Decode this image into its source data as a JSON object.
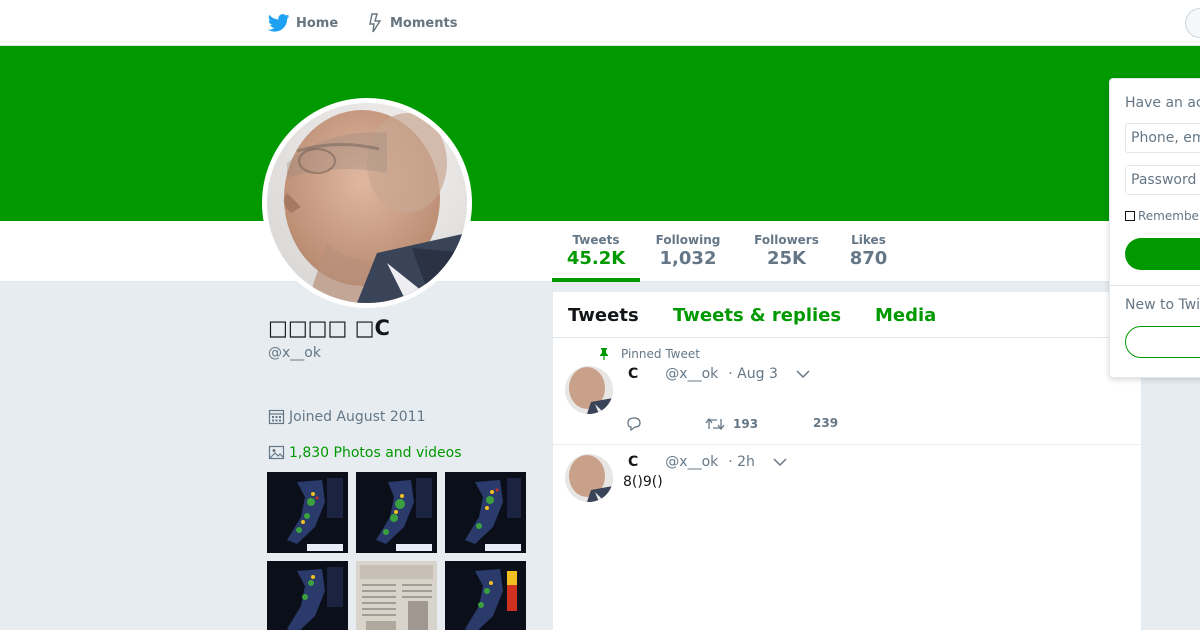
{
  "nav": {
    "home_label": "Home",
    "moments_label": "Moments"
  },
  "colors": {
    "theme": "#009900",
    "background": "#e6ecf0",
    "muted_text": "#657786"
  },
  "profile": {
    "name": "□□□□ □C",
    "handle": "@x__ok",
    "joined": "Joined August 2011",
    "photos_videos": "1,830 Photos and videos"
  },
  "stats": [
    {
      "label": "Tweets",
      "value": "45.2K"
    },
    {
      "label": "Following",
      "value": "1,032"
    },
    {
      "label": "Followers",
      "value": "25K"
    },
    {
      "label": "Likes",
      "value": "870"
    }
  ],
  "timeline": {
    "tabs": [
      "Tweets",
      "Tweets & replies",
      "Media"
    ],
    "pinned_label": "Pinned Tweet",
    "tweets": [
      {
        "name": "C",
        "handle": "@x__ok",
        "time": "· Aug 3",
        "text": "",
        "retweets": "193",
        "likes": "239"
      },
      {
        "name": "C",
        "handle": "@x__ok",
        "time": "· 2h",
        "text": "8()9()"
      }
    ]
  },
  "login": {
    "title": "Have an ac",
    "phone_placeholder": "Phone, em",
    "password_placeholder": "Password",
    "remember_label": "Remember",
    "new_to": "New to Twi"
  },
  "icons": [
    "twitter-bird-icon",
    "lightning-icon",
    "calendar-icon",
    "photo-icon",
    "pin-icon",
    "reply-icon",
    "retweet-icon",
    "heart-icon",
    "chevron-down-icon"
  ]
}
